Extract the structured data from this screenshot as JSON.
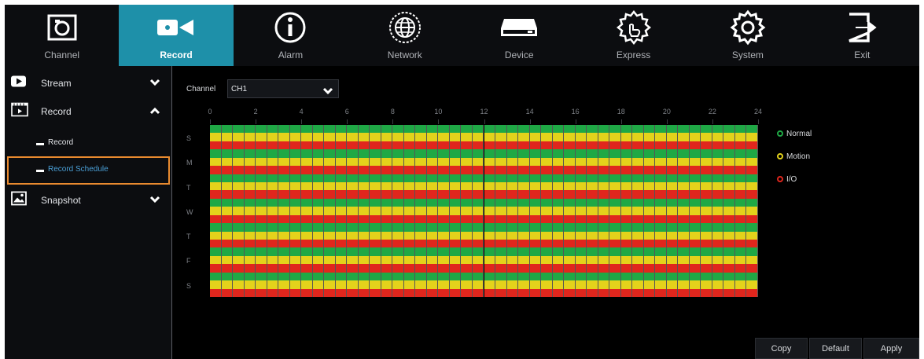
{
  "topnav": {
    "items": [
      {
        "label": "Channel",
        "icon": "camera-frame-icon",
        "active": false
      },
      {
        "label": "Record",
        "icon": "video-camera-icon",
        "active": true
      },
      {
        "label": "Alarm",
        "icon": "info-circle-icon",
        "active": false
      },
      {
        "label": "Network",
        "icon": "globe-icon",
        "active": false
      },
      {
        "label": "Device",
        "icon": "hard-drive-icon",
        "active": false
      },
      {
        "label": "Express",
        "icon": "hand-gear-icon",
        "active": false
      },
      {
        "label": "System",
        "icon": "gear-icon",
        "active": false
      },
      {
        "label": "Exit",
        "icon": "exit-icon",
        "active": false
      }
    ]
  },
  "sidebar": {
    "stream": {
      "label": "Stream",
      "icon": "play-icon",
      "expanded": false
    },
    "record": {
      "label": "Record",
      "icon": "film-icon",
      "expanded": true
    },
    "record_sub": [
      {
        "label": "Record",
        "selected": false
      },
      {
        "label": "Record Schedule",
        "selected": true
      }
    ],
    "snapshot": {
      "label": "Snapshot",
      "icon": "picture-icon",
      "expanded": false
    }
  },
  "main": {
    "channel_label": "Channel",
    "channel_value": "CH1",
    "hour_labels": [
      "0",
      "2",
      "4",
      "6",
      "8",
      "10",
      "12",
      "14",
      "16",
      "18",
      "20",
      "22",
      "24"
    ],
    "days": [
      "S",
      "M",
      "T",
      "W",
      "T",
      "F",
      "S"
    ],
    "slots_per_day": 48,
    "schedule_rows": [
      "Normal",
      "Motion",
      "I/O"
    ],
    "legend": [
      {
        "label": "Normal",
        "color": "#1fa845"
      },
      {
        "label": "Motion",
        "color": "#e4d21b"
      },
      {
        "label": "I/O",
        "color": "#e0261d"
      }
    ]
  },
  "buttons": {
    "copy": "Copy",
    "default": "Default",
    "apply": "Apply"
  },
  "colors": {
    "accent": "#1e90a9",
    "selection_border": "#e98a2f",
    "selected_text": "#4a9fd6",
    "grid_line": "#555555"
  }
}
